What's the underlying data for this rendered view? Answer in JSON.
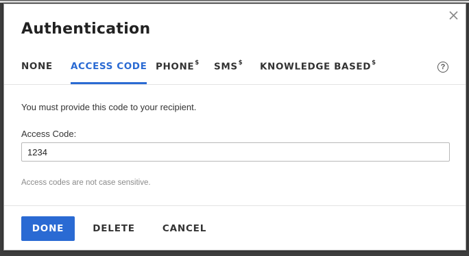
{
  "dialog": {
    "title": "Authentication",
    "close_icon": "close-icon",
    "help_icon": "help-icon",
    "help_glyph": "?"
  },
  "tabs": [
    {
      "label": "NONE",
      "sup": "",
      "active": false
    },
    {
      "label": "ACCESS CODE",
      "sup": "",
      "active": true
    },
    {
      "label": "PHONE",
      "sup": "$",
      "active": false
    },
    {
      "label": "SMS",
      "sup": "$",
      "active": false
    },
    {
      "label": "KNOWLEDGE BASED",
      "sup": "$",
      "active": false
    }
  ],
  "body": {
    "instruction": "You must provide this code to your recipient.",
    "field_label": "Access Code:",
    "field_value": "1234",
    "hint": "Access codes are not case sensitive."
  },
  "footer": {
    "done_label": "DONE",
    "delete_label": "DELETE",
    "cancel_label": "CANCEL"
  },
  "colors": {
    "accent": "#2a6ad3",
    "text": "#333333",
    "muted": "#8a8a8a"
  }
}
